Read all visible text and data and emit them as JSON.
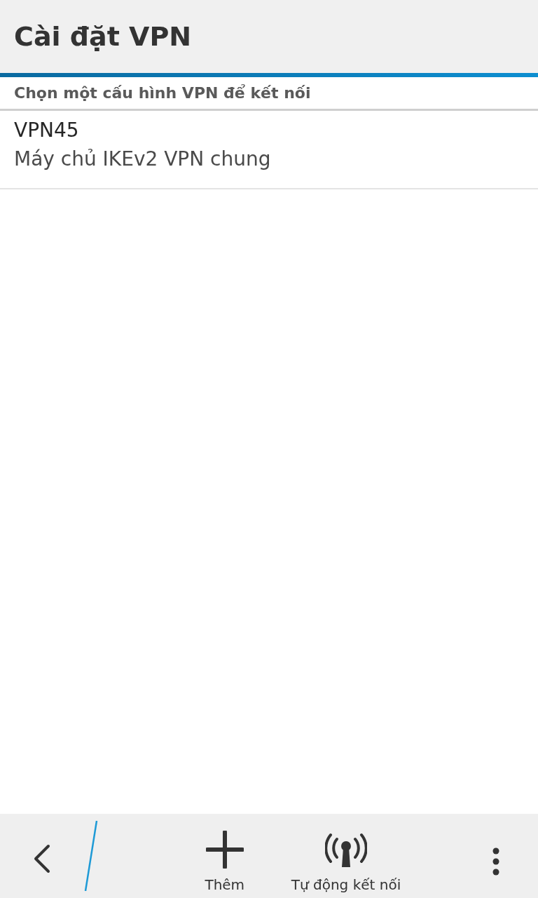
{
  "title": "Cài đặt VPN",
  "section_header": "Chọn một cấu hình VPN để kết nối",
  "profiles": [
    {
      "name": "VPN45",
      "description": "Máy chủ IKEv2 VPN chung"
    }
  ],
  "action_bar": {
    "actions": [
      {
        "kind": "add",
        "label": "Thêm"
      },
      {
        "kind": "broadcast",
        "label": "Tự động kết nối"
      }
    ]
  }
}
